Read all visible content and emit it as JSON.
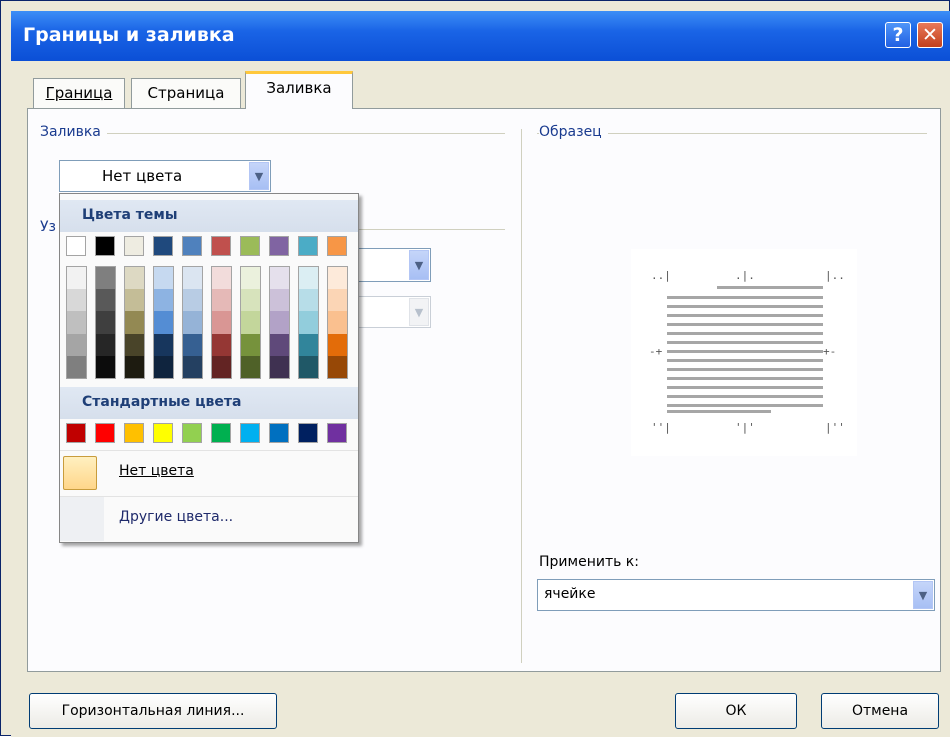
{
  "window": {
    "title": "Границы и заливка",
    "help_glyph": "?",
    "close_glyph": "✕"
  },
  "tabs": [
    {
      "label": "Граница",
      "active": false
    },
    {
      "label": "Страница",
      "active": false
    },
    {
      "label": "Заливка",
      "active": true
    }
  ],
  "fill": {
    "group_label": "Заливка",
    "selected_value": "Нет цвета",
    "pattern_label_partial": "Уз"
  },
  "color_picker": {
    "theme_header": "Цвета темы",
    "theme_colors": [
      "#ffffff",
      "#000000",
      "#eeece1",
      "#1f497d",
      "#4f81bd",
      "#c0504d",
      "#9bbb59",
      "#8064a2",
      "#4bacc6",
      "#f79646"
    ],
    "theme_shades": [
      [
        "#f2f2f2",
        "#d8d8d8",
        "#bfbfbf",
        "#a5a5a5",
        "#7f7f7f"
      ],
      [
        "#7f7f7f",
        "#595959",
        "#3f3f3f",
        "#262626",
        "#0c0c0c"
      ],
      [
        "#ddd9c3",
        "#c4bd97",
        "#938953",
        "#494429",
        "#1d1b10"
      ],
      [
        "#c6d9f0",
        "#8db3e2",
        "#548dd4",
        "#17365d",
        "#0f243e"
      ],
      [
        "#dbe5f1",
        "#b8cce4",
        "#95b3d7",
        "#366092",
        "#244061"
      ],
      [
        "#f2dcdb",
        "#e5b9b7",
        "#d99694",
        "#953734",
        "#632423"
      ],
      [
        "#ebf1dd",
        "#d7e3bc",
        "#c3d69b",
        "#76923c",
        "#4f6128"
      ],
      [
        "#e5e0ec",
        "#ccc1d9",
        "#b2a2c7",
        "#5f497a",
        "#3f3151"
      ],
      [
        "#dbeef3",
        "#b7dde8",
        "#92cddc",
        "#31859b",
        "#205867"
      ],
      [
        "#fdeada",
        "#fbd5b5",
        "#fac08f",
        "#e36c09",
        "#974806"
      ]
    ],
    "standard_header": "Стандартные цвета",
    "standard_colors": [
      "#c00000",
      "#ff0000",
      "#ffc000",
      "#ffff00",
      "#92d050",
      "#00b050",
      "#00b0f0",
      "#0070c0",
      "#002060",
      "#7030a0"
    ],
    "no_color_label": "Нет цвета",
    "more_colors_label": "Другие цвета..."
  },
  "preview": {
    "group_label": "Образец"
  },
  "apply_to": {
    "label": "Применить к:",
    "value": "ячейке"
  },
  "buttons": {
    "horizontal_line": "Горизонтальная линия...",
    "ok": "ОК",
    "cancel": "Отмена"
  }
}
